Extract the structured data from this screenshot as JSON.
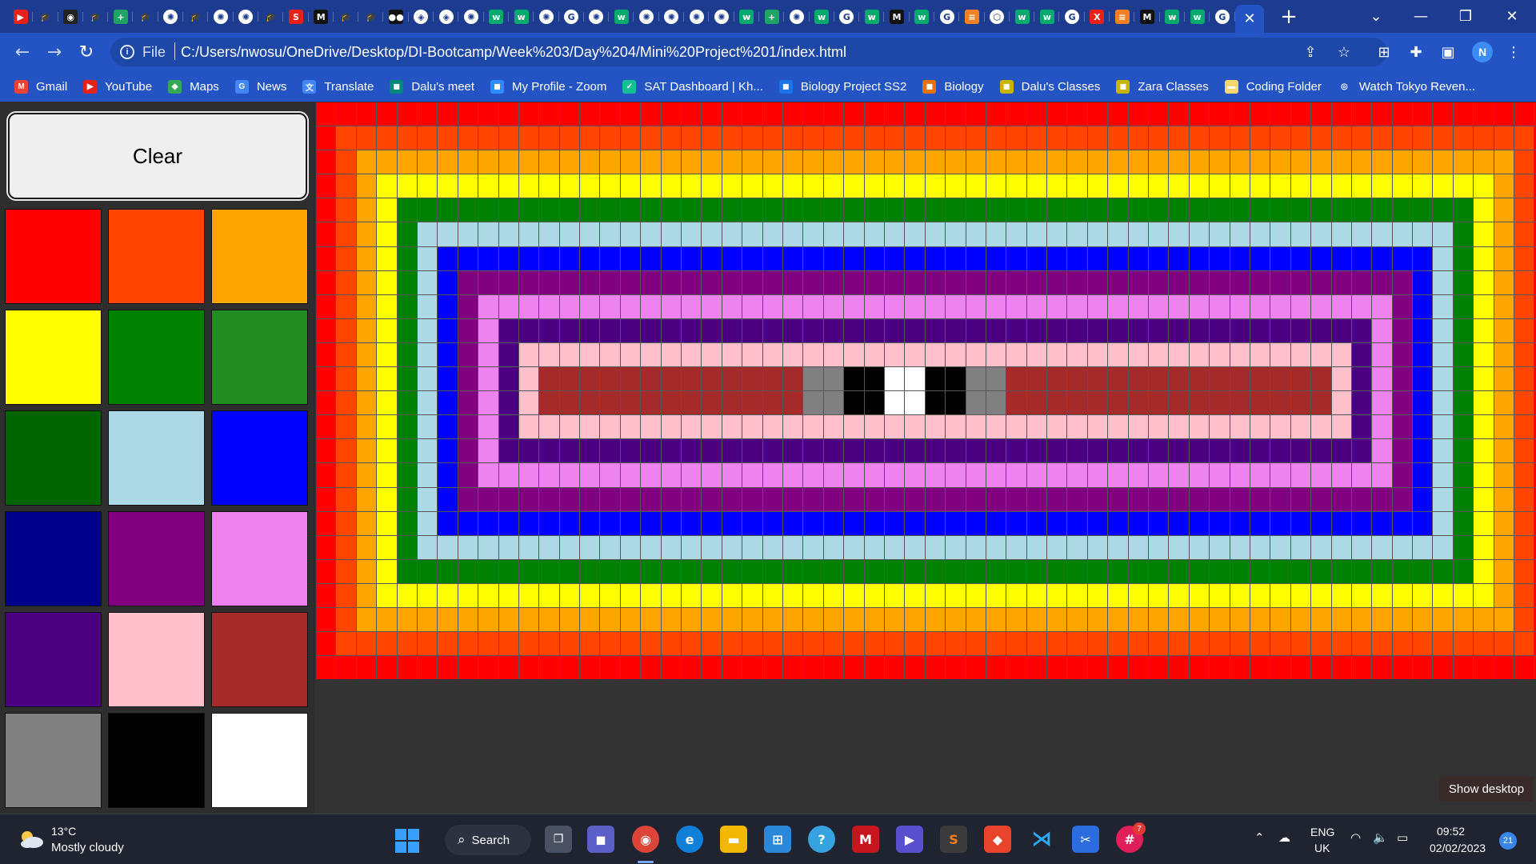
{
  "browser": {
    "tab_icons": [
      {
        "name": "youtube",
        "color": "#e62117",
        "glyph": "▶"
      },
      {
        "name": "graduation",
        "color": "#1d3c8f",
        "glyph": "🎓"
      },
      {
        "name": "github",
        "color": "#222222",
        "glyph": "◉"
      },
      {
        "name": "graduation",
        "color": "#1d3c8f",
        "glyph": "🎓"
      },
      {
        "name": "sheets",
        "color": "#1ea362",
        "glyph": "+"
      },
      {
        "name": "graduation",
        "color": "#1d3c8f",
        "glyph": "🎓"
      },
      {
        "name": "chatgpt",
        "color": "#ffffff",
        "glyph": "✺"
      },
      {
        "name": "graduation",
        "color": "#1d3c8f",
        "glyph": "🎓"
      },
      {
        "name": "chatgpt",
        "color": "#ffffff",
        "glyph": "✺"
      },
      {
        "name": "chatgpt",
        "color": "#ffffff",
        "glyph": "✺"
      },
      {
        "name": "graduation",
        "color": "#1d3c8f",
        "glyph": "🎓"
      },
      {
        "name": "scribd",
        "color": "#e62117",
        "glyph": "S"
      },
      {
        "name": "medium",
        "color": "#111111",
        "glyph": "M"
      },
      {
        "name": "graduation",
        "color": "#1d3c8f",
        "glyph": "🎓"
      },
      {
        "name": "graduation",
        "color": "#1d3c8f",
        "glyph": "🎓"
      },
      {
        "name": "medium-dots",
        "color": "#111111",
        "glyph": "●●"
      },
      {
        "name": "codepen",
        "color": "#ffffff",
        "glyph": "◈"
      },
      {
        "name": "codepen",
        "color": "#ffffff",
        "glyph": "◈"
      },
      {
        "name": "chatgpt",
        "color": "#ffffff",
        "glyph": "✺"
      },
      {
        "name": "w3schools",
        "color": "#04aa6d",
        "glyph": "w"
      },
      {
        "name": "w3schools",
        "color": "#04aa6d",
        "glyph": "w"
      },
      {
        "name": "chatgpt",
        "color": "#ffffff",
        "glyph": "✺"
      },
      {
        "name": "google",
        "color": "#ffffff",
        "glyph": "G"
      },
      {
        "name": "chatgpt",
        "color": "#ffffff",
        "glyph": "✺"
      },
      {
        "name": "w3schools",
        "color": "#04aa6d",
        "glyph": "w"
      },
      {
        "name": "chatgpt",
        "color": "#ffffff",
        "glyph": "✺"
      },
      {
        "name": "chatgpt",
        "color": "#ffffff",
        "glyph": "✺"
      },
      {
        "name": "chatgpt",
        "color": "#ffffff",
        "glyph": "✺"
      },
      {
        "name": "chatgpt",
        "color": "#ffffff",
        "glyph": "✺"
      },
      {
        "name": "w3schools",
        "color": "#04aa6d",
        "glyph": "w"
      },
      {
        "name": "sheets",
        "color": "#1ea362",
        "glyph": "+"
      },
      {
        "name": "chatgpt",
        "color": "#ffffff",
        "glyph": "✺"
      },
      {
        "name": "w3schools",
        "color": "#04aa6d",
        "glyph": "w"
      },
      {
        "name": "google",
        "color": "#ffffff",
        "glyph": "G"
      },
      {
        "name": "w3schools",
        "color": "#04aa6d",
        "glyph": "w"
      },
      {
        "name": "medium",
        "color": "#111111",
        "glyph": "M"
      },
      {
        "name": "w3schools",
        "color": "#04aa6d",
        "glyph": "w"
      },
      {
        "name": "google",
        "color": "#ffffff",
        "glyph": "G"
      },
      {
        "name": "stack",
        "color": "#f48024",
        "glyph": "≡"
      },
      {
        "name": "cube",
        "color": "#ffffff",
        "glyph": "⬡"
      },
      {
        "name": "w3schools",
        "color": "#04aa6d",
        "glyph": "w"
      },
      {
        "name": "w3schools",
        "color": "#04aa6d",
        "glyph": "w"
      },
      {
        "name": "google",
        "color": "#ffffff",
        "glyph": "G"
      },
      {
        "name": "x-red",
        "color": "#e62117",
        "glyph": "X"
      },
      {
        "name": "stack",
        "color": "#f48024",
        "glyph": "≡"
      },
      {
        "name": "medium",
        "color": "#111111",
        "glyph": "M"
      },
      {
        "name": "w3schools",
        "color": "#04aa6d",
        "glyph": "w"
      },
      {
        "name": "w3schools",
        "color": "#04aa6d",
        "glyph": "w"
      },
      {
        "name": "google",
        "color": "#ffffff",
        "glyph": "G"
      }
    ],
    "scheme_label": "File",
    "url": "C:/Users/nwosu/OneDrive/Desktop/DI-Bootcamp/Week%203/Day%204/Mini%20Project%201/index.html",
    "profile_initial": "N",
    "bookmarks": [
      {
        "label": "Gmail",
        "icon": "gmail-icon",
        "color": "#ea4335",
        "glyph": "M"
      },
      {
        "label": "YouTube",
        "icon": "youtube-icon",
        "color": "#e62117",
        "glyph": "▶"
      },
      {
        "label": "Maps",
        "icon": "maps-icon",
        "color": "#34a853",
        "glyph": "◆"
      },
      {
        "label": "News",
        "icon": "news-icon",
        "color": "#4285f4",
        "glyph": "G"
      },
      {
        "label": "Translate",
        "icon": "translate-icon",
        "color": "#4285f4",
        "glyph": "文"
      },
      {
        "label": "Dalu's meet",
        "icon": "meet-icon",
        "color": "#00897b",
        "glyph": "◼"
      },
      {
        "label": "My Profile - Zoom",
        "icon": "zoom-icon",
        "color": "#2d8cff",
        "glyph": "◼"
      },
      {
        "label": "SAT Dashboard | Kh...",
        "icon": "khan-icon",
        "color": "#14bf96",
        "glyph": "✓"
      },
      {
        "label": "Biology Project SS2",
        "icon": "classroom-icon",
        "color": "#1a73e8",
        "glyph": "◼"
      },
      {
        "label": "Biology",
        "icon": "classroom-icon",
        "color": "#e8710a",
        "glyph": "◼"
      },
      {
        "label": "Dalu's Classes",
        "icon": "classroom-icon",
        "color": "#c9b500",
        "glyph": "◼"
      },
      {
        "label": "Zara Classes",
        "icon": "classroom-icon",
        "color": "#c9b500",
        "glyph": "◼"
      },
      {
        "label": "Coding Folder",
        "icon": "folder-icon",
        "color": "#f5d76e",
        "glyph": "▬"
      },
      {
        "label": "Watch Tokyo Reven...",
        "icon": "globe-icon",
        "color": "#2454c4",
        "glyph": "◎"
      }
    ]
  },
  "app": {
    "clear_label": "Clear",
    "palette": [
      "#ff0000",
      "#ff4500",
      "#ffa500",
      "#ffff00",
      "#008000",
      "#228b22",
      "#006400",
      "#add8e6",
      "#0000ff",
      "#00008b",
      "#800080",
      "#ee82ee",
      "#4b0082",
      "#ffc0cb",
      "#a52a2a",
      "#808080",
      "#000000",
      "#ffffff"
    ],
    "grid_columns": 61,
    "grid_rows": 24,
    "ring_colors": [
      "#ff0000",
      "#ff4500",
      "#ffa500",
      "#ffff00",
      "#008000",
      "#add8e6",
      "#0000ff",
      "#800080",
      "#ee82ee",
      "#4b0082",
      "#ffc0cb",
      "#a52a2a"
    ],
    "center_strip": {
      "rows": [
        11,
        12
      ],
      "cells": {
        "24": "#808080",
        "25": "#808080",
        "26": "#000000",
        "27": "#000000",
        "28": "#ffffff",
        "29": "#ffffff",
        "30": "#000000",
        "31": "#000000",
        "32": "#808080",
        "33": "#808080"
      }
    }
  },
  "overlay": {
    "show_desktop": "Show desktop"
  },
  "taskbar": {
    "weather_temp": "13°C",
    "weather_desc": "Mostly cloudy",
    "search_label": "Search",
    "lang_line1": "ENG",
    "lang_line2": "UK",
    "time": "09:52",
    "date": "02/02/2023",
    "notification_count": "21",
    "badge_count": "7"
  }
}
